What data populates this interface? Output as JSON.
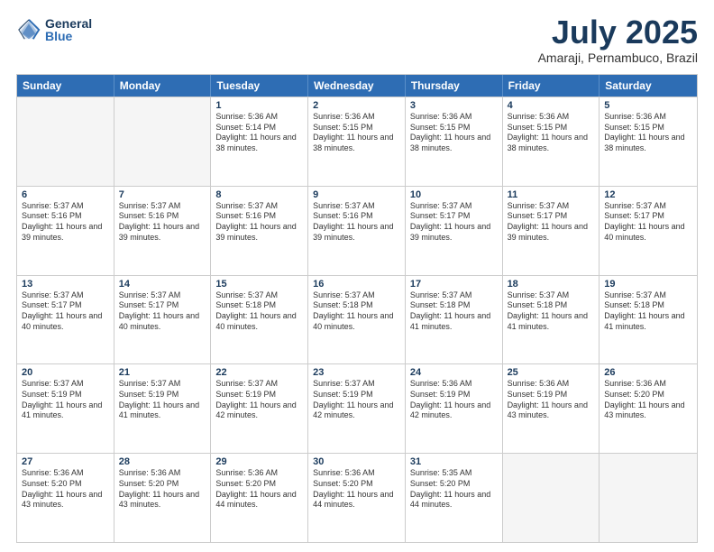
{
  "header": {
    "logo": {
      "line1": "General",
      "line2": "Blue"
    },
    "title": "July 2025",
    "subtitle": "Amaraji, Pernambuco, Brazil"
  },
  "days_of_week": [
    "Sunday",
    "Monday",
    "Tuesday",
    "Wednesday",
    "Thursday",
    "Friday",
    "Saturday"
  ],
  "weeks": [
    [
      {
        "day": "",
        "empty": true
      },
      {
        "day": "",
        "empty": true
      },
      {
        "day": "1",
        "sunrise": "Sunrise: 5:36 AM",
        "sunset": "Sunset: 5:14 PM",
        "daylight": "Daylight: 11 hours and 38 minutes."
      },
      {
        "day": "2",
        "sunrise": "Sunrise: 5:36 AM",
        "sunset": "Sunset: 5:15 PM",
        "daylight": "Daylight: 11 hours and 38 minutes."
      },
      {
        "day": "3",
        "sunrise": "Sunrise: 5:36 AM",
        "sunset": "Sunset: 5:15 PM",
        "daylight": "Daylight: 11 hours and 38 minutes."
      },
      {
        "day": "4",
        "sunrise": "Sunrise: 5:36 AM",
        "sunset": "Sunset: 5:15 PM",
        "daylight": "Daylight: 11 hours and 38 minutes."
      },
      {
        "day": "5",
        "sunrise": "Sunrise: 5:36 AM",
        "sunset": "Sunset: 5:15 PM",
        "daylight": "Daylight: 11 hours and 38 minutes."
      }
    ],
    [
      {
        "day": "6",
        "sunrise": "Sunrise: 5:37 AM",
        "sunset": "Sunset: 5:16 PM",
        "daylight": "Daylight: 11 hours and 39 minutes."
      },
      {
        "day": "7",
        "sunrise": "Sunrise: 5:37 AM",
        "sunset": "Sunset: 5:16 PM",
        "daylight": "Daylight: 11 hours and 39 minutes."
      },
      {
        "day": "8",
        "sunrise": "Sunrise: 5:37 AM",
        "sunset": "Sunset: 5:16 PM",
        "daylight": "Daylight: 11 hours and 39 minutes."
      },
      {
        "day": "9",
        "sunrise": "Sunrise: 5:37 AM",
        "sunset": "Sunset: 5:16 PM",
        "daylight": "Daylight: 11 hours and 39 minutes."
      },
      {
        "day": "10",
        "sunrise": "Sunrise: 5:37 AM",
        "sunset": "Sunset: 5:17 PM",
        "daylight": "Daylight: 11 hours and 39 minutes."
      },
      {
        "day": "11",
        "sunrise": "Sunrise: 5:37 AM",
        "sunset": "Sunset: 5:17 PM",
        "daylight": "Daylight: 11 hours and 39 minutes."
      },
      {
        "day": "12",
        "sunrise": "Sunrise: 5:37 AM",
        "sunset": "Sunset: 5:17 PM",
        "daylight": "Daylight: 11 hours and 40 minutes."
      }
    ],
    [
      {
        "day": "13",
        "sunrise": "Sunrise: 5:37 AM",
        "sunset": "Sunset: 5:17 PM",
        "daylight": "Daylight: 11 hours and 40 minutes."
      },
      {
        "day": "14",
        "sunrise": "Sunrise: 5:37 AM",
        "sunset": "Sunset: 5:17 PM",
        "daylight": "Daylight: 11 hours and 40 minutes."
      },
      {
        "day": "15",
        "sunrise": "Sunrise: 5:37 AM",
        "sunset": "Sunset: 5:18 PM",
        "daylight": "Daylight: 11 hours and 40 minutes."
      },
      {
        "day": "16",
        "sunrise": "Sunrise: 5:37 AM",
        "sunset": "Sunset: 5:18 PM",
        "daylight": "Daylight: 11 hours and 40 minutes."
      },
      {
        "day": "17",
        "sunrise": "Sunrise: 5:37 AM",
        "sunset": "Sunset: 5:18 PM",
        "daylight": "Daylight: 11 hours and 41 minutes."
      },
      {
        "day": "18",
        "sunrise": "Sunrise: 5:37 AM",
        "sunset": "Sunset: 5:18 PM",
        "daylight": "Daylight: 11 hours and 41 minutes."
      },
      {
        "day": "19",
        "sunrise": "Sunrise: 5:37 AM",
        "sunset": "Sunset: 5:18 PM",
        "daylight": "Daylight: 11 hours and 41 minutes."
      }
    ],
    [
      {
        "day": "20",
        "sunrise": "Sunrise: 5:37 AM",
        "sunset": "Sunset: 5:19 PM",
        "daylight": "Daylight: 11 hours and 41 minutes."
      },
      {
        "day": "21",
        "sunrise": "Sunrise: 5:37 AM",
        "sunset": "Sunset: 5:19 PM",
        "daylight": "Daylight: 11 hours and 41 minutes."
      },
      {
        "day": "22",
        "sunrise": "Sunrise: 5:37 AM",
        "sunset": "Sunset: 5:19 PM",
        "daylight": "Daylight: 11 hours and 42 minutes."
      },
      {
        "day": "23",
        "sunrise": "Sunrise: 5:37 AM",
        "sunset": "Sunset: 5:19 PM",
        "daylight": "Daylight: 11 hours and 42 minutes."
      },
      {
        "day": "24",
        "sunrise": "Sunrise: 5:36 AM",
        "sunset": "Sunset: 5:19 PM",
        "daylight": "Daylight: 11 hours and 42 minutes."
      },
      {
        "day": "25",
        "sunrise": "Sunrise: 5:36 AM",
        "sunset": "Sunset: 5:19 PM",
        "daylight": "Daylight: 11 hours and 43 minutes."
      },
      {
        "day": "26",
        "sunrise": "Sunrise: 5:36 AM",
        "sunset": "Sunset: 5:20 PM",
        "daylight": "Daylight: 11 hours and 43 minutes."
      }
    ],
    [
      {
        "day": "27",
        "sunrise": "Sunrise: 5:36 AM",
        "sunset": "Sunset: 5:20 PM",
        "daylight": "Daylight: 11 hours and 43 minutes."
      },
      {
        "day": "28",
        "sunrise": "Sunrise: 5:36 AM",
        "sunset": "Sunset: 5:20 PM",
        "daylight": "Daylight: 11 hours and 43 minutes."
      },
      {
        "day": "29",
        "sunrise": "Sunrise: 5:36 AM",
        "sunset": "Sunset: 5:20 PM",
        "daylight": "Daylight: 11 hours and 44 minutes."
      },
      {
        "day": "30",
        "sunrise": "Sunrise: 5:36 AM",
        "sunset": "Sunset: 5:20 PM",
        "daylight": "Daylight: 11 hours and 44 minutes."
      },
      {
        "day": "31",
        "sunrise": "Sunrise: 5:35 AM",
        "sunset": "Sunset: 5:20 PM",
        "daylight": "Daylight: 11 hours and 44 minutes."
      },
      {
        "day": "",
        "empty": true
      },
      {
        "day": "",
        "empty": true
      }
    ]
  ]
}
